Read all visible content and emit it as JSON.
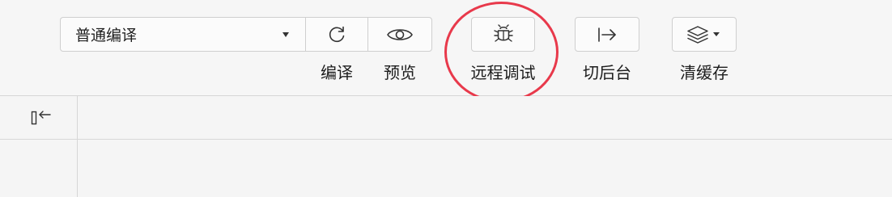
{
  "toolbar": {
    "compile_mode": {
      "selected": "普通编译"
    },
    "buttons": {
      "compile": {
        "label": "编译",
        "icon": "refresh-icon"
      },
      "preview": {
        "label": "预览",
        "icon": "eye-icon"
      },
      "remote_debug": {
        "label": "远程调试",
        "icon": "bug-icon"
      },
      "switch_background": {
        "label": "切后台",
        "icon": "exit-arrow-icon"
      },
      "clear_cache": {
        "label": "清缓存",
        "icon": "layers-icon"
      }
    }
  },
  "annotation": {
    "color": "#e8394b"
  },
  "sidebar": {
    "collapse_icon": "collapse-left-icon"
  }
}
